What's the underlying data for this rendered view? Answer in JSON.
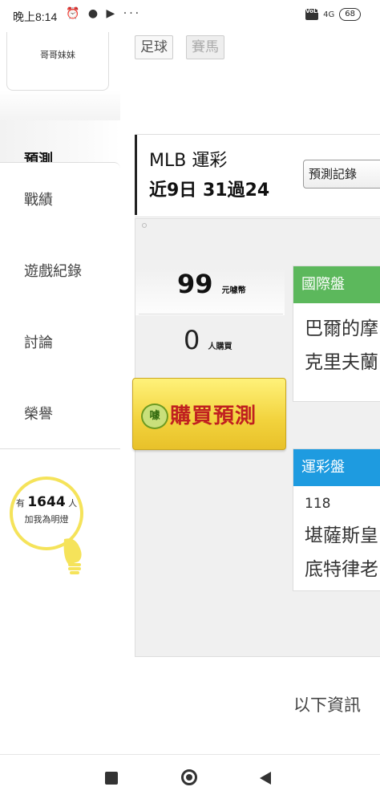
{
  "status_bar": {
    "time": "晚上8:14",
    "left_icons": "⏰ ● ▶ ···",
    "network": "4G",
    "volte": "VoLTE",
    "battery": "68"
  },
  "sidebar": {
    "user_name": "哥哥妹妹",
    "active_item": "預測",
    "items": [
      "戰績",
      "遊戲紀錄",
      "討論",
      "榮譽"
    ],
    "lamp": {
      "prefix": "有",
      "count": "1644",
      "suffix": "人",
      "caption": "加我為明燈"
    }
  },
  "main": {
    "tags": [
      "足球",
      "賽馬"
    ],
    "prediction": {
      "title": "MLB 運彩",
      "record": "近9日 31過24",
      "record_button": "預測記錄"
    },
    "price": {
      "value": "99",
      "unit": "元噱幣"
    },
    "buyers": {
      "value": "0",
      "unit": "人購買"
    },
    "buy_button": "購買預測",
    "buy_coin": "噱",
    "cards": [
      {
        "header": "國際盤",
        "color": "#5cb85c",
        "number": "",
        "lines": [
          "巴爾的摩",
          "克里夫蘭"
        ]
      },
      {
        "header": "運彩盤",
        "color": "#1e9be0",
        "number": "118",
        "lines": [
          "堪薩斯皇",
          "底特律老"
        ]
      }
    ],
    "footer_text": "以下資訊"
  },
  "icons": {
    "nav": [
      "square-icon",
      "home-circle-icon",
      "back-triangle-icon"
    ]
  }
}
